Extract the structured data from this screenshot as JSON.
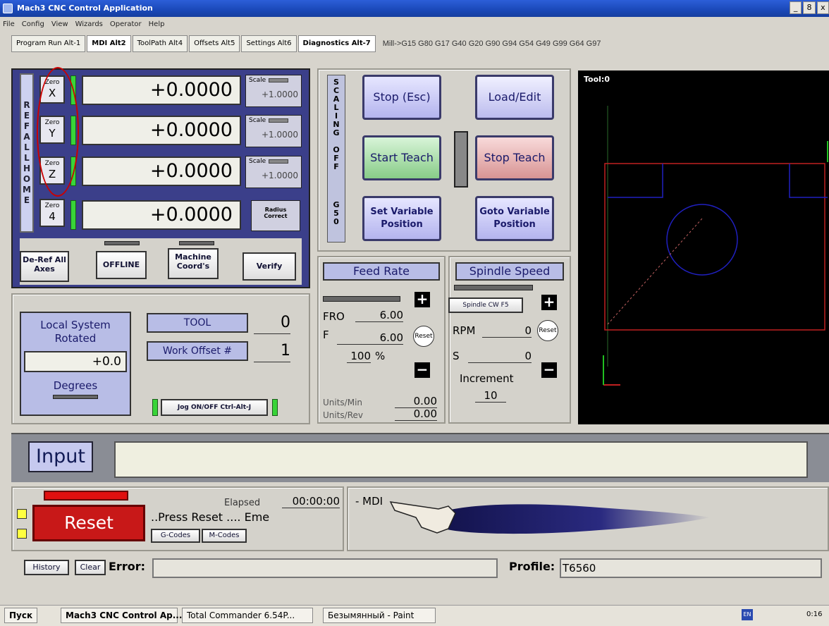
{
  "window": {
    "title": "Mach3 CNC Control Application",
    "buttons": [
      "_",
      "8",
      "x"
    ]
  },
  "menu": [
    "File",
    "Config",
    "View",
    "Wizards",
    "Operator",
    "Help"
  ],
  "tabs": [
    "Program Run Alt-1",
    "MDI Alt2",
    "ToolPath Alt4",
    "Offsets Alt5",
    "Settings Alt6",
    "Diagnostics Alt-7"
  ],
  "gcode_status": "Mill->G15  G80 G17 G40 G20 G90 G94 G54 G49 G99 G64 G97",
  "dro": {
    "refall": [
      "R",
      "E",
      "F",
      "A",
      "L",
      "L",
      "H",
      "O",
      "M",
      "E"
    ],
    "axes": [
      {
        "zero": "Zero",
        "axis": "X",
        "value": "+0.0000",
        "scale_label": "Scale",
        "scale_value": "+1.0000"
      },
      {
        "zero": "Zero",
        "axis": "Y",
        "value": "+0.0000",
        "scale_label": "Scale",
        "scale_value": "+1.0000"
      },
      {
        "zero": "Zero",
        "axis": "Z",
        "value": "+0.0000",
        "scale_label": "Scale",
        "scale_value": "+1.0000"
      },
      {
        "zero": "Zero",
        "axis": "4",
        "value": "+0.0000",
        "scale_label": "Radius Correct",
        "scale_value": ""
      }
    ],
    "buttons": {
      "deref": "De-Ref All Axes",
      "offline": "OFFLINE",
      "machine": "Machine Coord's",
      "verify": "Verify"
    }
  },
  "scaling": [
    "S",
    "C",
    "A",
    "L",
    "I",
    "N",
    "G",
    "",
    "O",
    "F",
    "F",
    "",
    "G",
    "5",
    "0"
  ],
  "center_buttons": {
    "stop": "Stop (Esc)",
    "load": "Load/Edit",
    "start_teach": "Start Teach",
    "stop_teach": "Stop Teach",
    "set_var": "Set Variable Position",
    "goto_var": "Goto Variable Position"
  },
  "toolpath": {
    "label": "Tool:0"
  },
  "feed": {
    "header": "Feed Rate",
    "fro_label": "FRO",
    "fro": "6.00",
    "f_label": "F",
    "f": "6.00",
    "pct": "100",
    "pct_sign": "%",
    "reset": "Reset",
    "units_min_label": "Units/Min",
    "units_min": "0.00",
    "units_rev_label": "Units/Rev",
    "units_rev": "0.00"
  },
  "spindle": {
    "header": "Spindle Speed",
    "cw": "Spindle CW F5",
    "rpm_label": "RPM",
    "rpm": "0",
    "s_label": "S",
    "s": "0",
    "reset": "Reset",
    "increment_label": "Increment",
    "increment": "10"
  },
  "local": {
    "title": "Local System Rotated",
    "value": "+0.0",
    "degrees": "Degrees",
    "tool_label": "TOOL",
    "tool": "0",
    "offset_label": "Work Offset #",
    "offset": "1",
    "jog": "Jog ON/OFF Ctrl-Alt-J"
  },
  "input": {
    "label": "Input"
  },
  "status": {
    "reset": "Reset",
    "elapsed_label": "Elapsed",
    "elapsed": "00:00:00",
    "message": "..Press Reset .... Eme",
    "gcodes": "G-Codes",
    "mcodes": "M-Codes",
    "mdi": "- MDI"
  },
  "history": {
    "history": "History",
    "clear": "Clear",
    "error_label": "Error:",
    "profile_label": "Profile:",
    "profile": "T6560"
  },
  "taskbar": {
    "start": "Пуск",
    "tasks": [
      "Mach3 CNC Control Ap...",
      "Total Commander 6.54P...",
      "Безымянный - Paint"
    ],
    "lang": "EN",
    "time": "0:16"
  }
}
